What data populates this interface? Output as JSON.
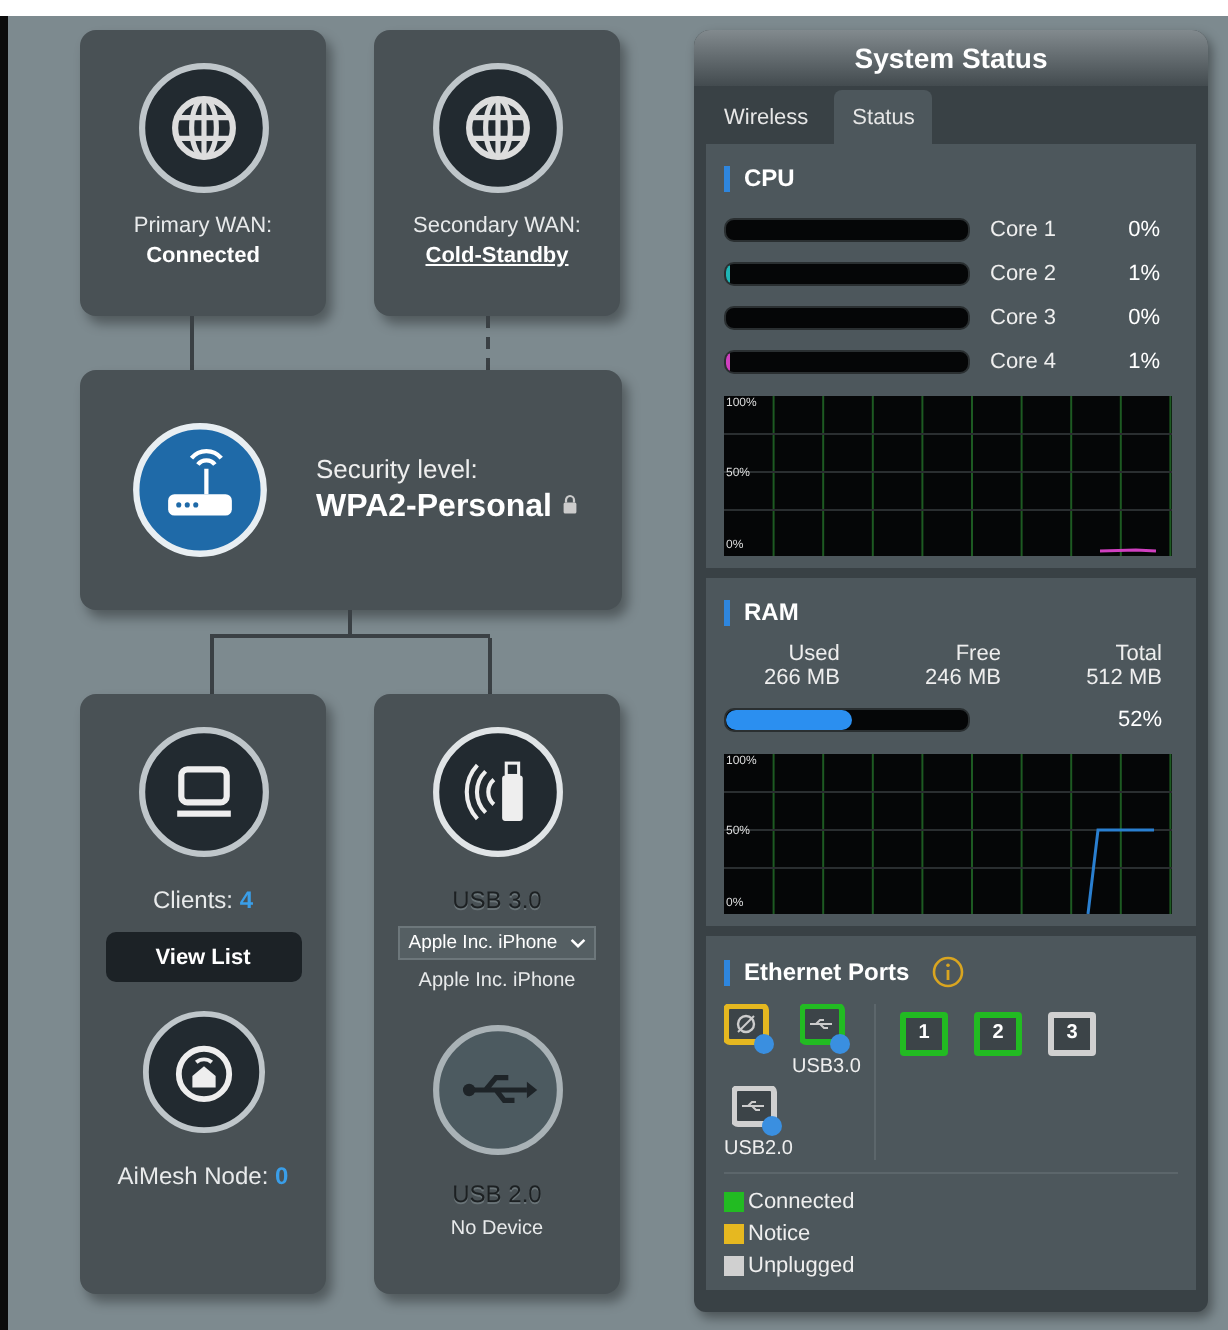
{
  "wan": [
    {
      "label": "Primary WAN:",
      "status": "Connected",
      "status_link": false
    },
    {
      "label": "Secondary WAN:",
      "status": "Cold-Standby",
      "status_link": true
    }
  ],
  "security": {
    "label": "Security level:",
    "value": "WPA2-Personal"
  },
  "clients": {
    "label": "Clients:",
    "count": "4",
    "button": "View List",
    "aimesh_label": "AiMesh Node:",
    "aimesh_count": "0"
  },
  "usb": [
    {
      "label": "USB 3.0",
      "select": "Apple Inc. iPhone",
      "device": "Apple Inc. iPhone",
      "disabled": false
    },
    {
      "label": "USB 2.0",
      "device": "No Device",
      "disabled": true
    }
  ],
  "system_status": {
    "title": "System Status",
    "tabs": [
      {
        "label": "Wireless",
        "selected": false
      },
      {
        "label": "Status",
        "selected": true
      }
    ],
    "cpu": {
      "title": "CPU",
      "cores": [
        {
          "name": "Core 1",
          "reading": "0%"
        },
        {
          "name": "Core 2",
          "reading": "1%",
          "level": 0.01,
          "color": "#1fb5b5"
        },
        {
          "name": "Core 3",
          "reading": "0%"
        },
        {
          "name": "Core 4",
          "reading": "1%",
          "level": 0.01,
          "color": "#d040c0"
        }
      ],
      "graph_labels": [
        "100%",
        "50%",
        "0%"
      ]
    },
    "ram": {
      "title": "RAM",
      "columns": [
        {
          "label": "Used",
          "value": "266 MB"
        },
        {
          "label": "Free",
          "value": "246 MB"
        },
        {
          "label": "Total",
          "value": "512 MB"
        }
      ],
      "level": 0.52,
      "reading": "52%",
      "graph_labels": [
        "100%",
        "50%",
        "0%"
      ]
    },
    "ethernet": {
      "title": "Ethernet Ports",
      "usb_ports": [
        {
          "kind": "wan",
          "color": "#e6b820"
        },
        {
          "kind": "usb",
          "label": "USB3.0",
          "color": "#22bb22"
        },
        {
          "kind": "usb",
          "label": "USB2.0",
          "color": "#d0d0d0"
        }
      ],
      "lan_ports": [
        {
          "label": "1",
          "color": "#22bb22"
        },
        {
          "label": "2",
          "color": "#22bb22"
        },
        {
          "label": "3",
          "color": "#d0d0d0"
        }
      ],
      "legend": [
        {
          "label": "Connected",
          "color": "#22bb22"
        },
        {
          "label": "Notice",
          "color": "#e6b820"
        },
        {
          "label": "Unplugged",
          "color": "#d0d0d0"
        }
      ]
    }
  }
}
